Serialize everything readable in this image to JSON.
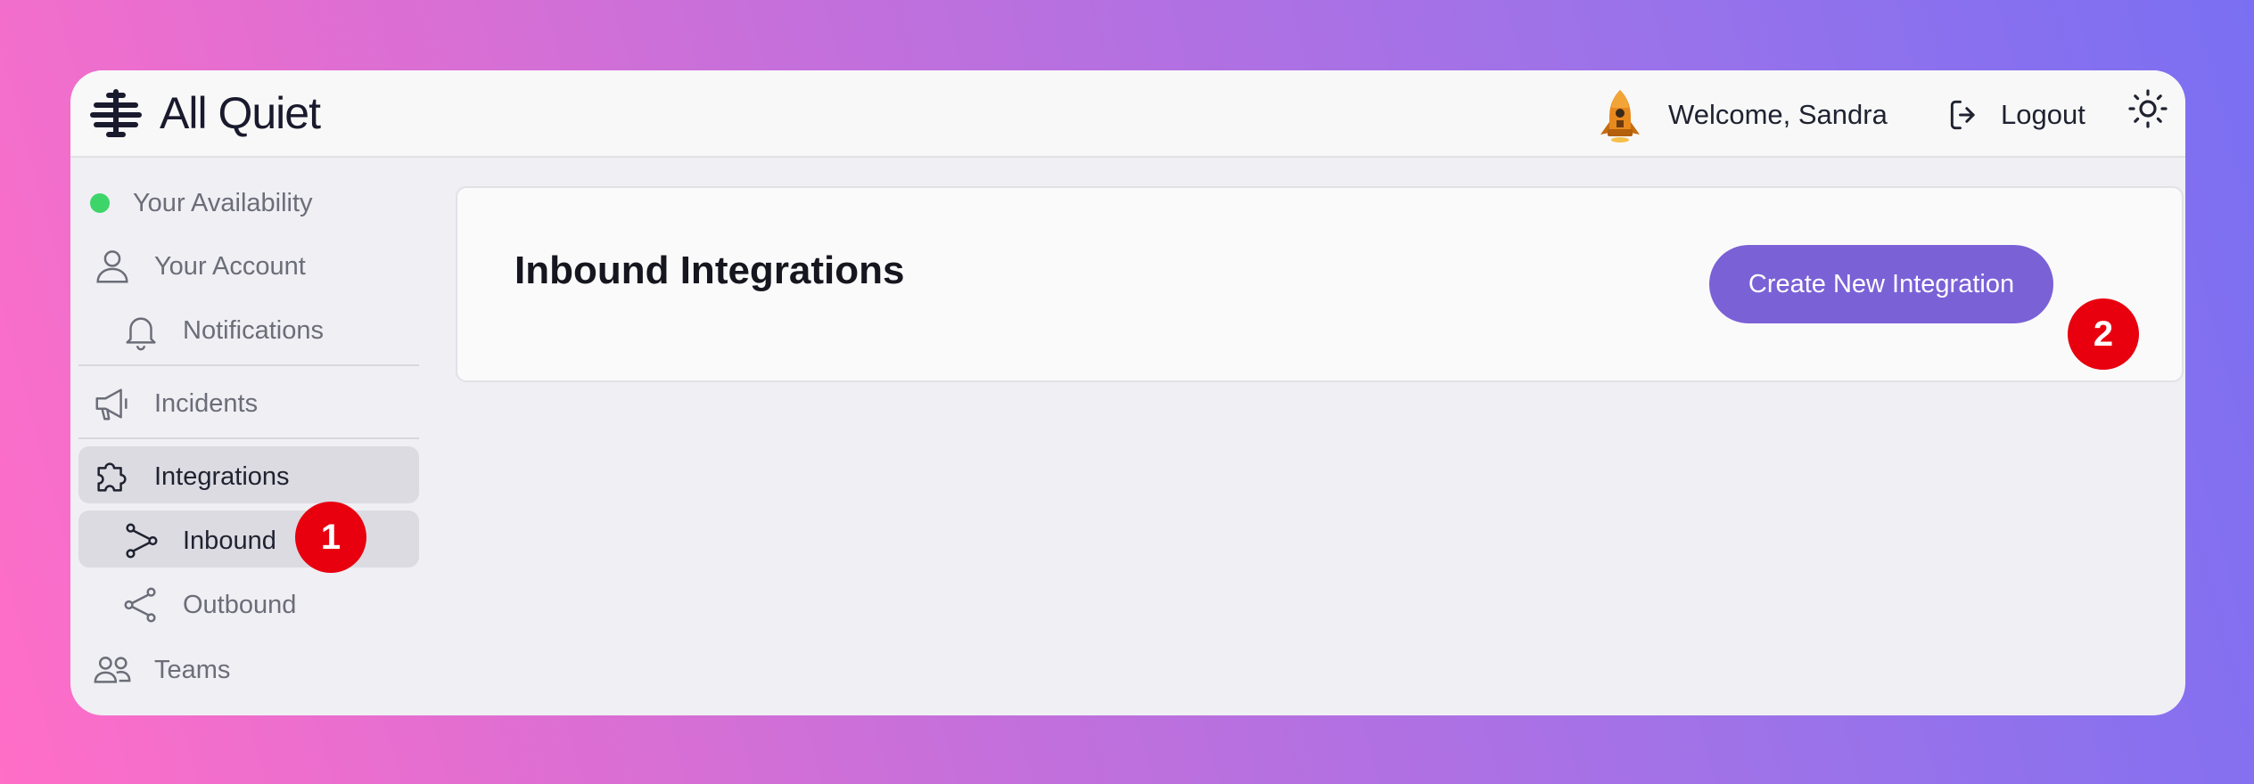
{
  "app": {
    "name": "All Quiet"
  },
  "header": {
    "welcome": "Welcome, Sandra",
    "logout_label": "Logout",
    "avatar_icon": "rocket-avatar-icon",
    "theme_icon": "sun-icon"
  },
  "sidebar": {
    "availability": {
      "label": "Your Availability",
      "status_color": "#3dd56a"
    },
    "items": [
      {
        "label": "Your Account",
        "icon": "user-icon"
      },
      {
        "label": "Notifications",
        "icon": "bell-icon"
      },
      {
        "label": "Incidents",
        "icon": "megaphone-icon"
      },
      {
        "label": "Integrations",
        "icon": "puzzle-icon"
      },
      {
        "label": "Inbound",
        "icon": "inbound-icon"
      },
      {
        "label": "Outbound",
        "icon": "share-icon"
      },
      {
        "label": "Teams",
        "icon": "users-icon"
      }
    ]
  },
  "main": {
    "title": "Inbound Integrations",
    "create_button": "Create New Integration"
  },
  "annotations": {
    "badge1": "1",
    "badge2": "2"
  },
  "colors": {
    "accent": "#7a61d6",
    "badge": "#e8000f"
  }
}
